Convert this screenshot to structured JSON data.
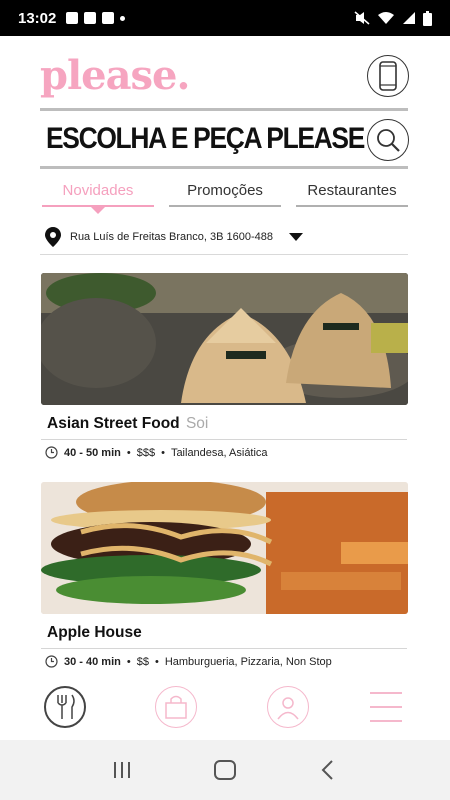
{
  "status": {
    "time": "13:02"
  },
  "header": {
    "logo": "please.",
    "headline": "ESCOLHA E PEÇA PLEASE"
  },
  "tabs": [
    {
      "label": "Novidades",
      "active": true
    },
    {
      "label": "Promoções",
      "active": false
    },
    {
      "label": "Restaurantes",
      "active": false
    }
  ],
  "location": {
    "address": "Rua Luís de Freitas Branco, 3B 1600-488"
  },
  "restaurants": [
    {
      "name": "Asian Street Food",
      "subtitle": "Soi",
      "time": "40 - 50 min",
      "price": "$$$",
      "cuisine": "Tailandesa, Asiática",
      "image": "dumplings-photo"
    },
    {
      "name": "Apple House",
      "subtitle": "",
      "time": "30 - 40 min",
      "price": "$$",
      "cuisine": "Hamburgueria, Pizzaria, Non Stop",
      "image": "burger-photo"
    }
  ],
  "bottom_nav": [
    "fork-knife-icon",
    "bag-icon",
    "user-icon",
    "menu-icon"
  ],
  "colors": {
    "accent": "#f5a0be",
    "text": "#111111"
  }
}
